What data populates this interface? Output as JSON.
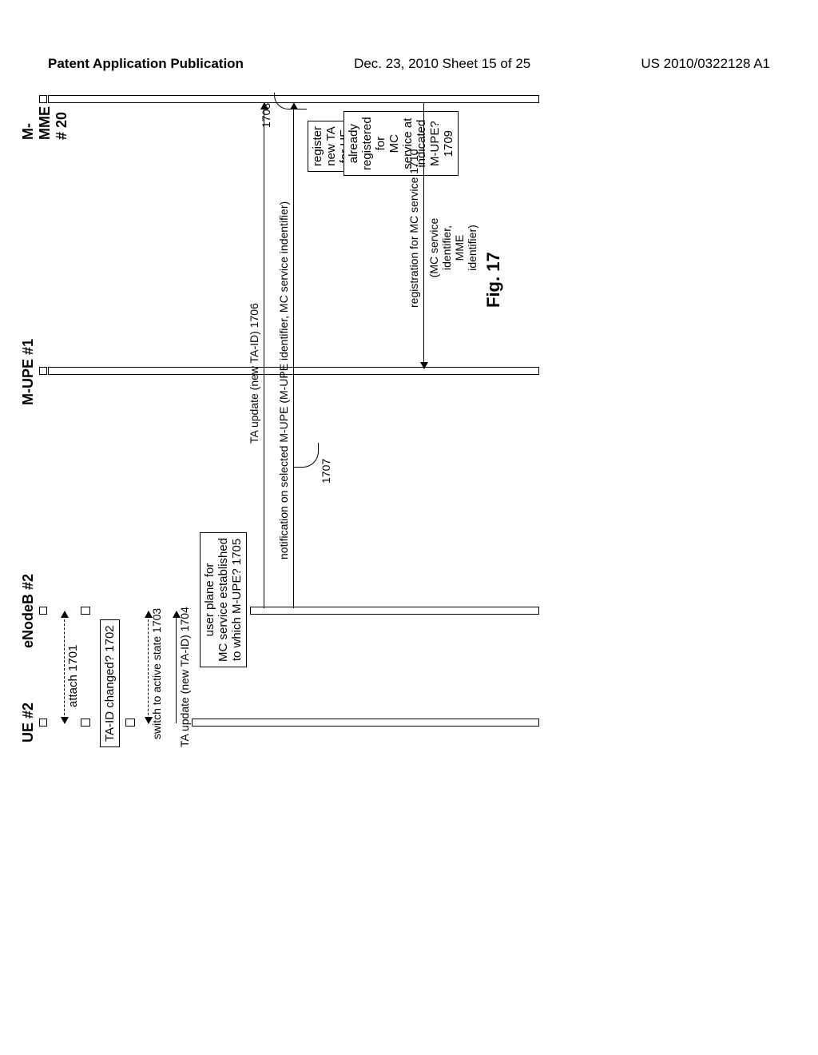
{
  "header": {
    "left": "Patent Application Publication",
    "center": "Dec. 23, 2010  Sheet 15 of 25",
    "right": "US 2010/0322128 A1"
  },
  "actors": {
    "ue": "UE #2",
    "enb": "eNodeB #2",
    "mupe": "M-UPE #1",
    "mmme": "M-MME # 20"
  },
  "labels": {
    "attach": "attach 1701",
    "ta_changed": "TA-ID changed? 1702",
    "switch_active": "switch to active state 1703",
    "ta_update_enb": "TA update (new TA-ID) 1704",
    "user_plane": "user plane for\nMC service established\nto which M-UPE? 1705",
    "ta_update_mmme": "TA update (new TA-ID) 1706",
    "notification": "notification on selected M-UPE (M-UPE identifier, MC service indentifier)",
    "n1707": "1707",
    "register_new": "register new TA for UE #2",
    "n1708": "1708",
    "already_reg": "already registered for\nMC service at\nindicated M-UPE? 1709",
    "registration": "registration for MC service 1710",
    "reg_params": "(MC service identifier,\nMME identifier)"
  },
  "figure": "Fig. 17"
}
